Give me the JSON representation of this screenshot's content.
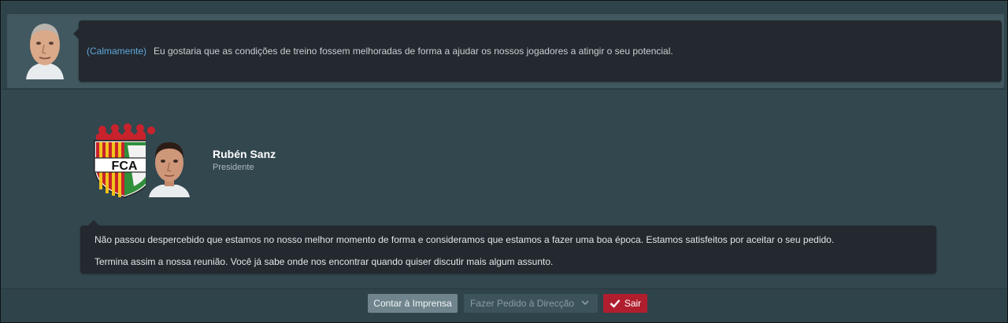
{
  "manager": {
    "tone": "(Calmamente)",
    "statement": "Eu gostaria que as condições de treino fossem melhoradas de forma a ajudar os nossos jogadores a atingir o seu potencial."
  },
  "president": {
    "name": "Rubén Sanz",
    "role": "Presidente",
    "crest_text": "FCA",
    "response_lines": [
      "Não passou despercebido que estamos no nosso melhor momento de forma e consideramos que estamos a fazer uma boa época. Estamos satisfeitos por aceitar o seu pedido.",
      "Termina assim a nossa reunião. Você já sabe onde nos encontrar quando quiser discutir mais algum assunto."
    ]
  },
  "actions": {
    "press_label": "Contar à Imprensa",
    "board_request_label": "Fazer Pedido à Direcção",
    "exit_label": "Sair"
  },
  "icons": {
    "board_dropdown": "chevron-down-icon",
    "exit": "check-icon"
  },
  "colors": {
    "tone_accent": "#5fa6dc",
    "exit_button": "#b01e2e"
  }
}
